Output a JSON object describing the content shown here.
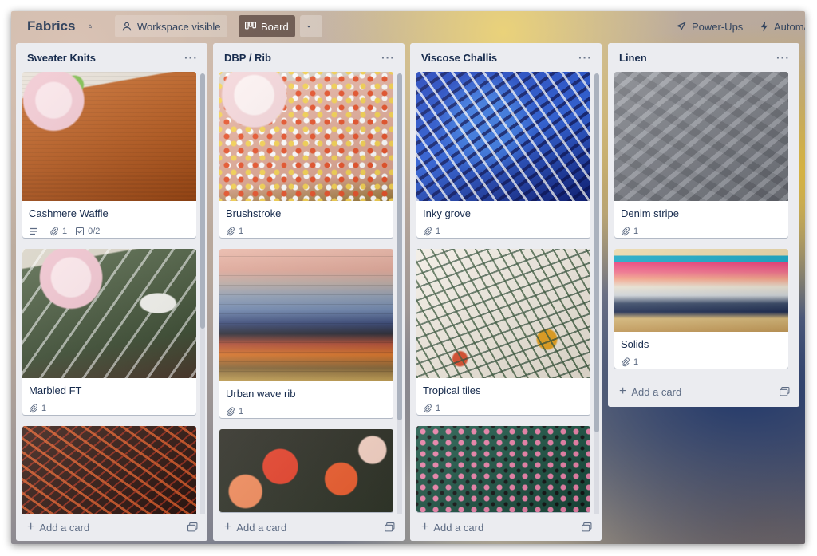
{
  "board": {
    "title": "Fabrics",
    "visibility_label": "Workspace visible",
    "view_label": "Board",
    "powerups_label": "Power-Ups",
    "automation_label": "Automa"
  },
  "lists": [
    {
      "title": "Sweater Knits",
      "menu": "···",
      "add_card_label": "Add a card",
      "cards": [
        {
          "title": "Cashmere Waffle",
          "attachments": "1",
          "checklist": "0/2",
          "has_description": true,
          "cover": "rust-orange waffle knit with peony"
        },
        {
          "title": "Marbled FT",
          "attachments": "1",
          "cover": "olive green marbled french terry with peony"
        },
        {
          "title": "",
          "cover": "dark brown with red leaf print"
        }
      ]
    },
    {
      "title": "DBP / Rib",
      "menu": "···",
      "add_card_label": "Add a card",
      "cards": [
        {
          "title": "Brushstroke",
          "attachments": "1",
          "cover": "pink brushstroke spots with peony"
        },
        {
          "title": "Urban wave rib",
          "attachments": "1",
          "cover": "stack of rib knits in pastel to earth tones"
        },
        {
          "title": "",
          "cover": "dark floral with red blooms"
        }
      ]
    },
    {
      "title": "Viscose Challis",
      "menu": "···",
      "add_card_label": "Add a card",
      "cards": [
        {
          "title": "Inky grove",
          "attachments": "1",
          "cover": "cobalt blue leaf print"
        },
        {
          "title": "Tropical tiles",
          "attachments": "1",
          "cover": "white with green palm leaves"
        },
        {
          "title": "",
          "cover": "teal with pink leopard spots"
        }
      ]
    },
    {
      "title": "Linen",
      "menu": "···",
      "add_card_label": "Add a card",
      "cards": [
        {
          "title": "Denim stripe",
          "attachments": "1",
          "cover": "grey crumpled linen"
        },
        {
          "title": "Solids",
          "attachments": "1",
          "cover": "stack of solid colour linens"
        }
      ]
    }
  ],
  "colors": {
    "list_background": "#ebecf0",
    "card_background": "#ffffff",
    "text_primary": "#172b4d",
    "text_secondary": "#5e6c84",
    "header_dark_button": "#5a3c34"
  }
}
